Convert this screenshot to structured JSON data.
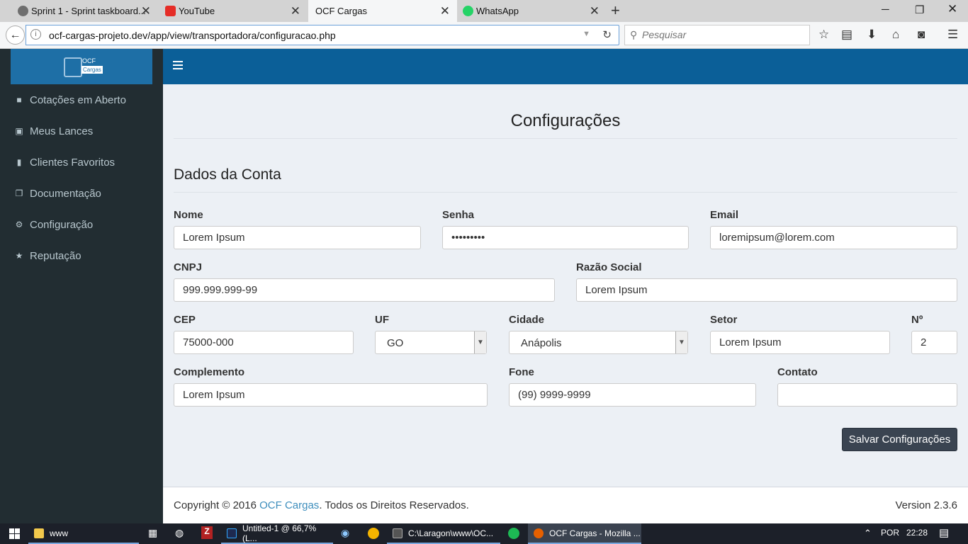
{
  "browser": {
    "tabs": [
      {
        "title": "Sprint 1 - Sprint taskboard...",
        "color": "#6f6f6f"
      },
      {
        "title": "YouTube",
        "color": "#e52d27"
      },
      {
        "title": "OCF Cargas",
        "color": "#f5f6f7"
      },
      {
        "title": "WhatsApp",
        "color": "#25d366"
      }
    ],
    "url": "ocf-cargas-projeto.dev/app/view/transportadora/configuracao.php",
    "search_placeholder": "Pesquisar"
  },
  "sidebar": {
    "logo_line1": "OCF",
    "logo_line2": "Cargas",
    "items": [
      {
        "label": "Cotações em Aberto",
        "icon": "truck-icon"
      },
      {
        "label": "Meus Lances",
        "icon": "money-icon"
      },
      {
        "label": "Clientes Favoritos",
        "icon": "bookmark-icon"
      },
      {
        "label": "Documentação",
        "icon": "copy-icon"
      },
      {
        "label": "Configuração",
        "icon": "cogs-icon"
      },
      {
        "label": "Reputação",
        "icon": "star-icon"
      }
    ]
  },
  "page": {
    "title": "Configurações",
    "section_title": "Dados da Conta",
    "fields": {
      "nome": {
        "label": "Nome",
        "value": "Lorem Ipsum"
      },
      "senha": {
        "label": "Senha",
        "value": "•••••••••"
      },
      "email": {
        "label": "Email",
        "value": "loremipsum@lorem.com"
      },
      "cnpj": {
        "label": "CNPJ",
        "value": "999.999.999-99"
      },
      "razao": {
        "label": "Razão Social",
        "value": "Lorem Ipsum"
      },
      "cep": {
        "label": "CEP",
        "value": "75000-000"
      },
      "uf": {
        "label": "UF",
        "value": "GO"
      },
      "cidade": {
        "label": "Cidade",
        "value": "Anápolis"
      },
      "setor": {
        "label": "Setor",
        "value": "Lorem Ipsum"
      },
      "numero": {
        "label": "Nº",
        "value": "2"
      },
      "complemento": {
        "label": "Complemento",
        "value": "Lorem Ipsum"
      },
      "fone": {
        "label": "Fone",
        "value": "(99) 9999-9999"
      },
      "contato": {
        "label": "Contato",
        "value": ""
      }
    },
    "save_label": "Salvar Configurações"
  },
  "footer": {
    "copyright_prefix": "Copyright © 2016",
    "brand": "OCF Cargas",
    "copyright_suffix": ". Todos os Direitos Reservados.",
    "version": "Version 2.3.6"
  },
  "taskbar": {
    "items": [
      {
        "label": "www"
      },
      {
        "label": "Untitled-1 @ 66,7% (L..."
      },
      {
        "label": "C:\\Laragon\\www\\OC..."
      },
      {
        "label": "OCF Cargas - Mozilla ..."
      }
    ],
    "language": "POR",
    "time": "22:28"
  }
}
